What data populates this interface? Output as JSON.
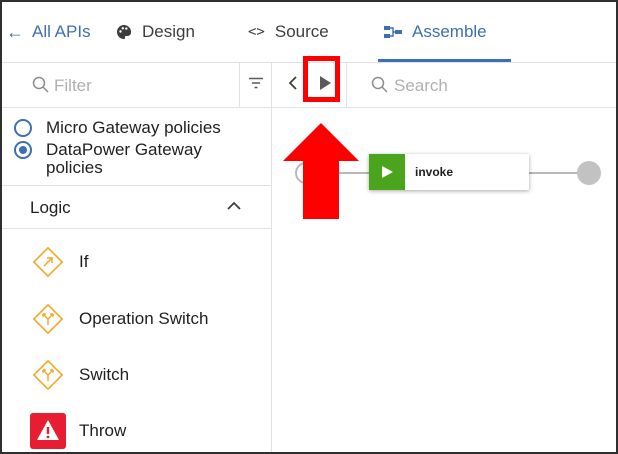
{
  "nav": {
    "back_label": "All APIs",
    "design_label": "Design",
    "source_label": "Source",
    "assemble_label": "Assemble",
    "source_glyph": "<>",
    "back_arrow": "←"
  },
  "palette": {
    "filter_placeholder": "Filter",
    "gateways": [
      {
        "label": "Micro Gateway policies",
        "checked": false
      },
      {
        "label": "DataPower Gateway policies",
        "checked": true
      }
    ],
    "section_title": "Logic",
    "policies": [
      {
        "label": "If",
        "icon": "if-diamond-icon"
      },
      {
        "label": "Operation Switch",
        "icon": "operation-switch-diamond-icon"
      },
      {
        "label": "Switch",
        "icon": "switch-diamond-icon"
      },
      {
        "label": "Throw",
        "icon": "throw-warning-icon"
      }
    ]
  },
  "canvas": {
    "search_placeholder": "Search",
    "invoke_label": "invoke"
  },
  "colors": {
    "accent": "#3d70b2",
    "logic_icon": "#f5a623",
    "throw_icon": "#e71d32",
    "invoke_icon": "#4aa51c",
    "annotation": "#ff0000"
  }
}
